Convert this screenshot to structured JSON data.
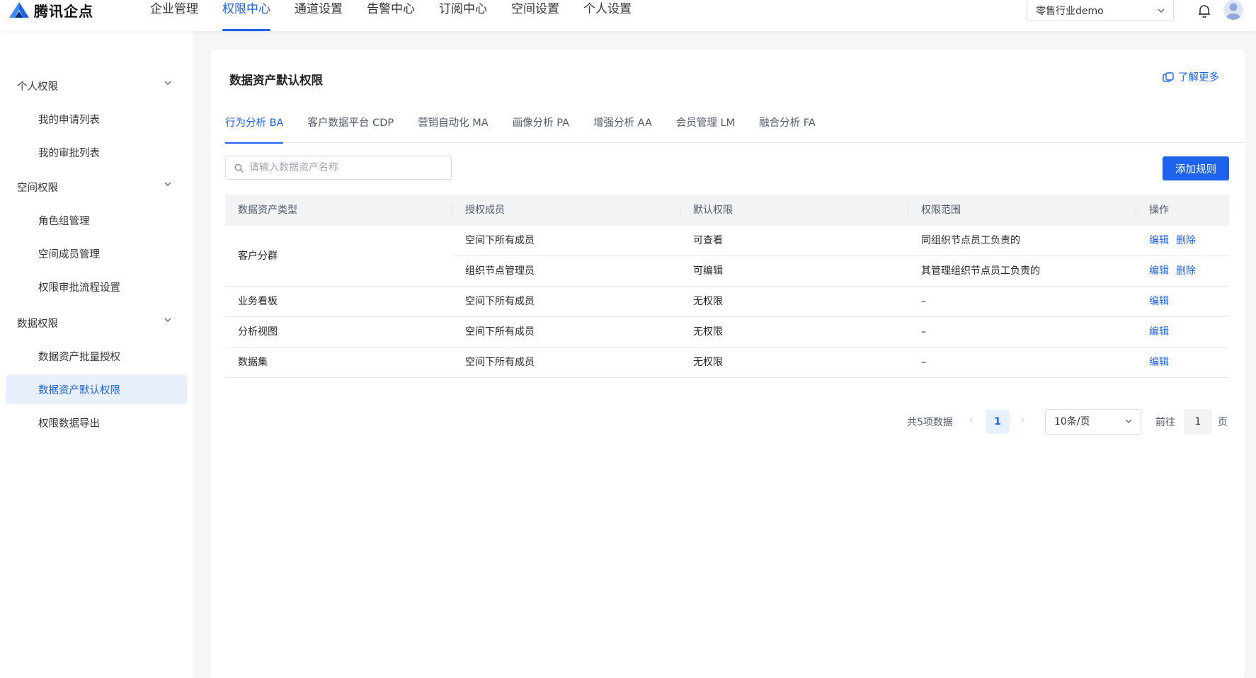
{
  "app": {
    "logo_text": "腾讯企点"
  },
  "topnav": {
    "items": [
      "企业管理",
      "权限中心",
      "通道设置",
      "告警中心",
      "订阅中心",
      "空间设置",
      "个人设置"
    ],
    "active_index": 1,
    "org_select": "零售行业demo"
  },
  "sidebar": {
    "groups": [
      {
        "label": "个人权限",
        "items": [
          "我的申请列表",
          "我的审批列表"
        ]
      },
      {
        "label": "空间权限",
        "items": [
          "角色组管理",
          "空间成员管理",
          "权限审批流程设置"
        ]
      },
      {
        "label": "数据权限",
        "items": [
          "数据资产批量授权",
          "数据资产默认权限",
          "权限数据导出"
        ]
      }
    ],
    "active_item": "数据资产默认权限"
  },
  "page": {
    "title": "数据资产默认权限",
    "learn_more": "了解更多",
    "tabs": [
      "行为分析 BA",
      "客户数据平台 CDP",
      "营销自动化 MA",
      "画像分析 PA",
      "增强分析 AA",
      "会员管理 LM",
      "融合分析 FA"
    ],
    "active_tab": 0,
    "search_placeholder": "请输入数据资产名称",
    "add_button": "添加规则"
  },
  "table": {
    "columns": [
      "数据资产类型",
      "授权成员",
      "默认权限",
      "权限范围",
      "操作"
    ],
    "rows": [
      {
        "type": "客户分群",
        "member": "空间下所有成员",
        "permission": "可查看",
        "scope": "同组织节点员工负责的",
        "actions": [
          "编辑",
          "删除"
        ]
      },
      {
        "type": "",
        "member": "组织节点管理员",
        "permission": "可编辑",
        "scope": "其管理组织节点员工负责的",
        "actions": [
          "编辑",
          "删除"
        ]
      },
      {
        "type": "业务看板",
        "member": "空间下所有成员",
        "permission": "无权限",
        "scope": "–",
        "actions": [
          "编辑"
        ]
      },
      {
        "type": "分析视图",
        "member": "空间下所有成员",
        "permission": "无权限",
        "scope": "–",
        "actions": [
          "编辑"
        ]
      },
      {
        "type": "数据集",
        "member": "空间下所有成员",
        "permission": "无权限",
        "scope": "–",
        "actions": [
          "编辑"
        ]
      }
    ]
  },
  "pagination": {
    "total": "共5项数据",
    "current_page": "1",
    "page_size": "10条/页",
    "goto_label": "前往",
    "goto_value": "1",
    "page_label": "页"
  },
  "colors": {
    "primary": "#1d63ed",
    "active_bg": "#e8f0fd"
  }
}
